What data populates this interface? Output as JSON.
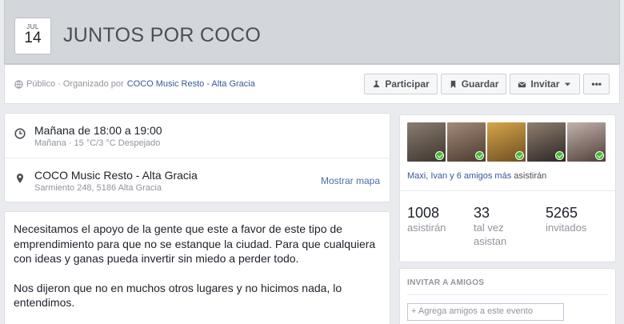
{
  "event": {
    "month": "JUL",
    "day": "14",
    "title": "JUNTOS POR COCO"
  },
  "actionbar": {
    "privacy": "Público · Organizado por",
    "organizer": "COCO Music Resto - Alta Gracia",
    "buttons": {
      "participar": "Participar",
      "guardar": "Guardar",
      "invitar": "Invitar",
      "more": "•••"
    }
  },
  "info": {
    "time_main": "Mañana de 18:00 a 19:00",
    "time_sub": "Mañana · 15 °C/3 °C Despejado",
    "place_main": "COCO Music Resto - Alta Gracia",
    "place_sub": "Sarmiento 248, 5186 Alta Gracia",
    "map_link": "Mostrar mapa"
  },
  "description": {
    "p1": "Necesitamos el apoyo de la gente que este a favor de este tipo de emprendimiento para que no se estanque la ciudad. Para que cualquiera con ideas y ganas pueda invertir sin miedo a perder todo.",
    "p2": "Nos dijeron que no en muchos otros lugares y no hicimos nada, lo entendimos."
  },
  "going": {
    "friends_text": "Maxi, Ivan y 6 amigos más",
    "friends_rest": " asistirán",
    "avatar_colors": [
      "#5a4e44",
      "#6b5546",
      "#8a6a2f",
      "#4a4038",
      "#7d6b66"
    ],
    "stats": [
      {
        "num": "1008",
        "label": "asistirán"
      },
      {
        "num": "33",
        "label": "tal vez asistan"
      },
      {
        "num": "5265",
        "label": "invitados"
      }
    ]
  },
  "invite": {
    "header": "INVITAR A AMIGOS",
    "placeholder": "+ Agrega amigos a este evento"
  }
}
